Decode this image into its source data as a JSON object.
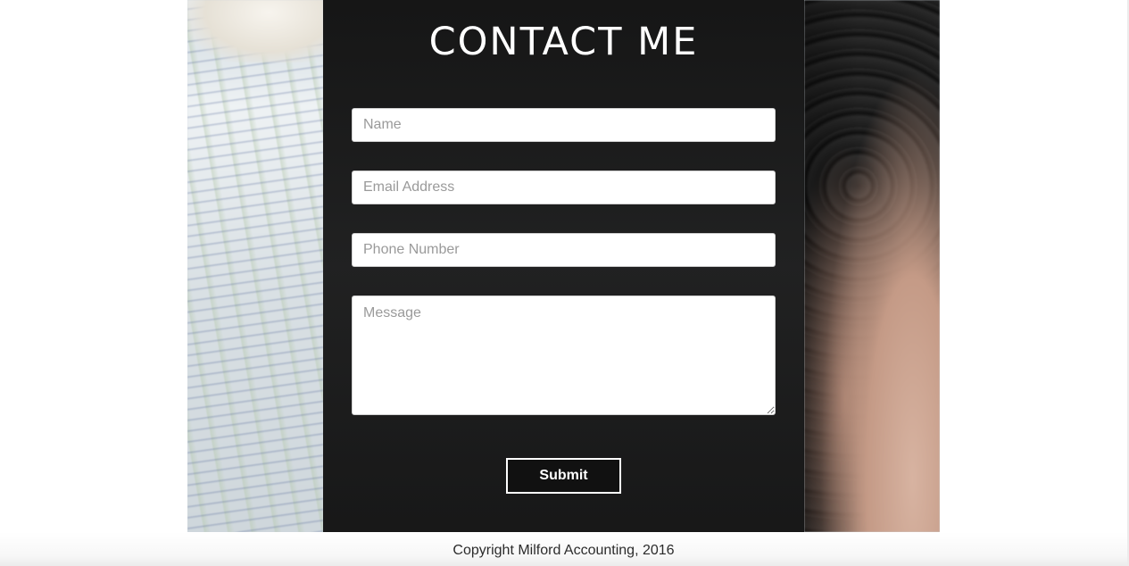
{
  "contact": {
    "title": "CONTACT ME",
    "name_placeholder": "Name",
    "email_placeholder": "Email Address",
    "phone_placeholder": "Phone Number",
    "message_placeholder": "Message",
    "submit_label": "Submit"
  },
  "footer": {
    "copyright": "Copyright Milford Accounting, 2016"
  },
  "colors": {
    "panel_background": "#141414",
    "title_text": "#ffffff",
    "button_border": "#ffffff"
  }
}
